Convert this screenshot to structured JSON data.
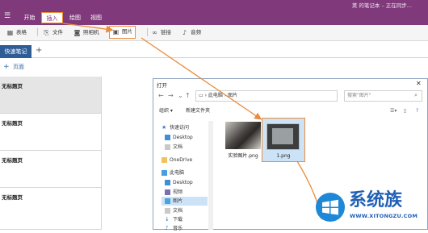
{
  "window": {
    "title": "荚 的笔记本 – 正在同步..."
  },
  "menu": {
    "tabs": [
      {
        "label": "开始"
      },
      {
        "label": "插入"
      },
      {
        "label": "绘图"
      },
      {
        "label": "视图"
      }
    ],
    "active": "插入"
  },
  "ribbon": {
    "items": [
      {
        "label": "表格",
        "icon": "table-icon"
      },
      {
        "label": "文件",
        "icon": "paperclip-icon"
      },
      {
        "label": "照相机",
        "icon": "camera-icon"
      },
      {
        "label": "图片",
        "icon": "picture-icon"
      },
      {
        "label": "链接",
        "icon": "link-icon"
      },
      {
        "label": "音频",
        "icon": "microphone-icon"
      }
    ],
    "highlighted": "图片"
  },
  "sections": {
    "active_tab": "快速笔记",
    "add_label": "+"
  },
  "pages": {
    "add_label": "页面",
    "items": [
      {
        "title": "无标题页"
      },
      {
        "title": "无标题页"
      },
      {
        "title": "无标题页"
      },
      {
        "title": "无标题页"
      }
    ]
  },
  "dialog": {
    "title": "打开",
    "address": [
      "此电脑",
      "图片"
    ],
    "search_placeholder": "搜索\"图片\"",
    "toolbar": {
      "organize": "组织",
      "new_folder": "新建文件夹"
    },
    "nav": [
      {
        "label": "快速访问",
        "icon": "star-icon"
      },
      {
        "label": "Desktop",
        "icon": "desktop-icon"
      },
      {
        "label": "文档",
        "icon": "document-icon"
      },
      {
        "label": "OneDrive",
        "icon": "cloud-icon"
      },
      {
        "label": "此电脑",
        "icon": "computer-icon"
      },
      {
        "label": "Desktop",
        "icon": "desktop-icon"
      },
      {
        "label": "视频",
        "icon": "video-icon"
      },
      {
        "label": "图片",
        "icon": "picture-icon"
      },
      {
        "label": "文档",
        "icon": "document-icon"
      },
      {
        "label": "下载",
        "icon": "download-icon"
      },
      {
        "label": "音乐",
        "icon": "music-icon"
      }
    ],
    "files": [
      {
        "name": "实验图片.png"
      },
      {
        "name": "1.png"
      }
    ]
  },
  "watermark": {
    "brand": "系统族",
    "url": "WWW.XITONGZU.COM"
  },
  "colors": {
    "title_bg": "#80397b",
    "section_tab": "#2e5d96",
    "highlight": "#e98b3a",
    "selection": "#cce3f7"
  }
}
